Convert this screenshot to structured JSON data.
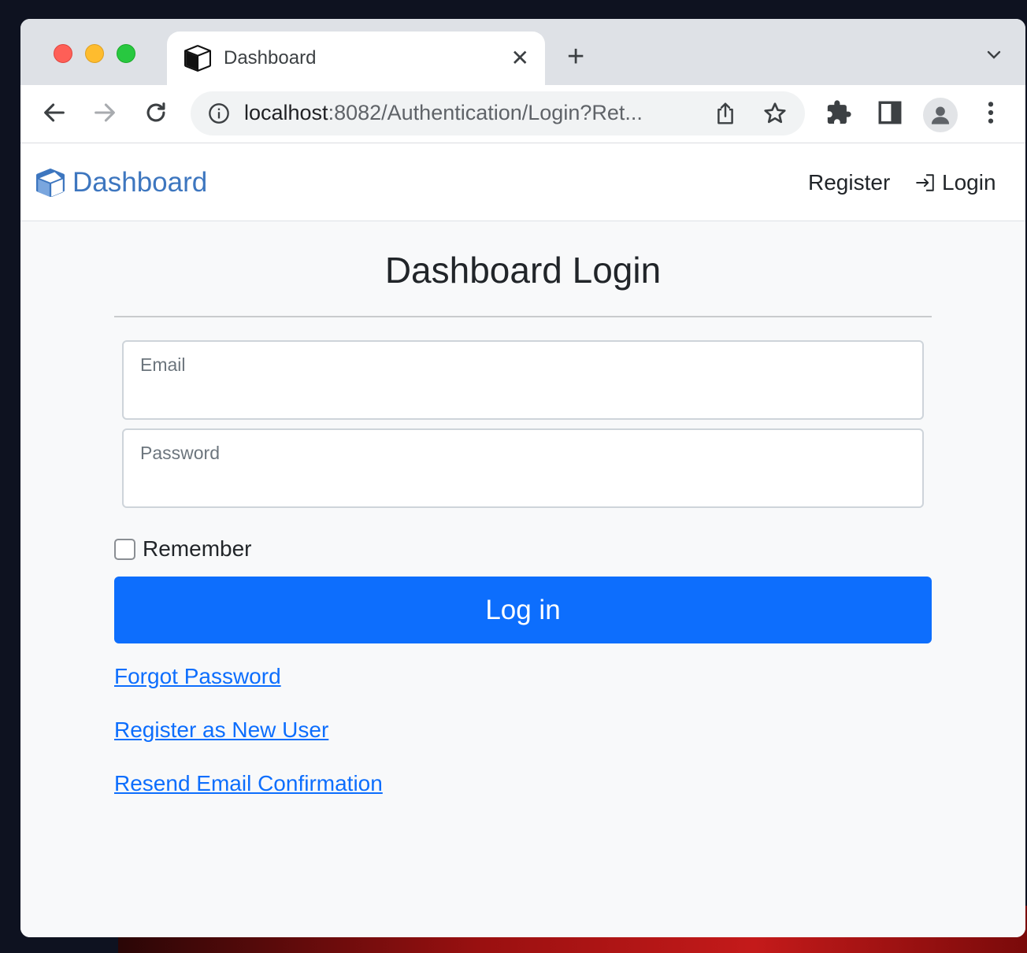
{
  "browser": {
    "tab": {
      "title": "Dashboard",
      "favicon": "package-icon"
    },
    "address_bar": {
      "url_host": "localhost",
      "url_rest": ":8082/Authentication/Login?Ret..."
    }
  },
  "navbar": {
    "brand": {
      "label": "Dashboard",
      "icon": "package-icon",
      "color": "#3d76bf"
    },
    "links": {
      "register": "Register",
      "login": "Login"
    }
  },
  "login_form": {
    "title": "Dashboard Login",
    "email": {
      "label": "Email",
      "value": ""
    },
    "password": {
      "label": "Password",
      "value": ""
    },
    "remember": {
      "label": "Remember",
      "checked": false
    },
    "submit_label": "Log in",
    "submit_color": "#0d6efd"
  },
  "links": {
    "forgot_password": "Forgot Password",
    "register_new_user": "Register as New User",
    "resend_confirmation": "Resend Email Confirmation"
  }
}
